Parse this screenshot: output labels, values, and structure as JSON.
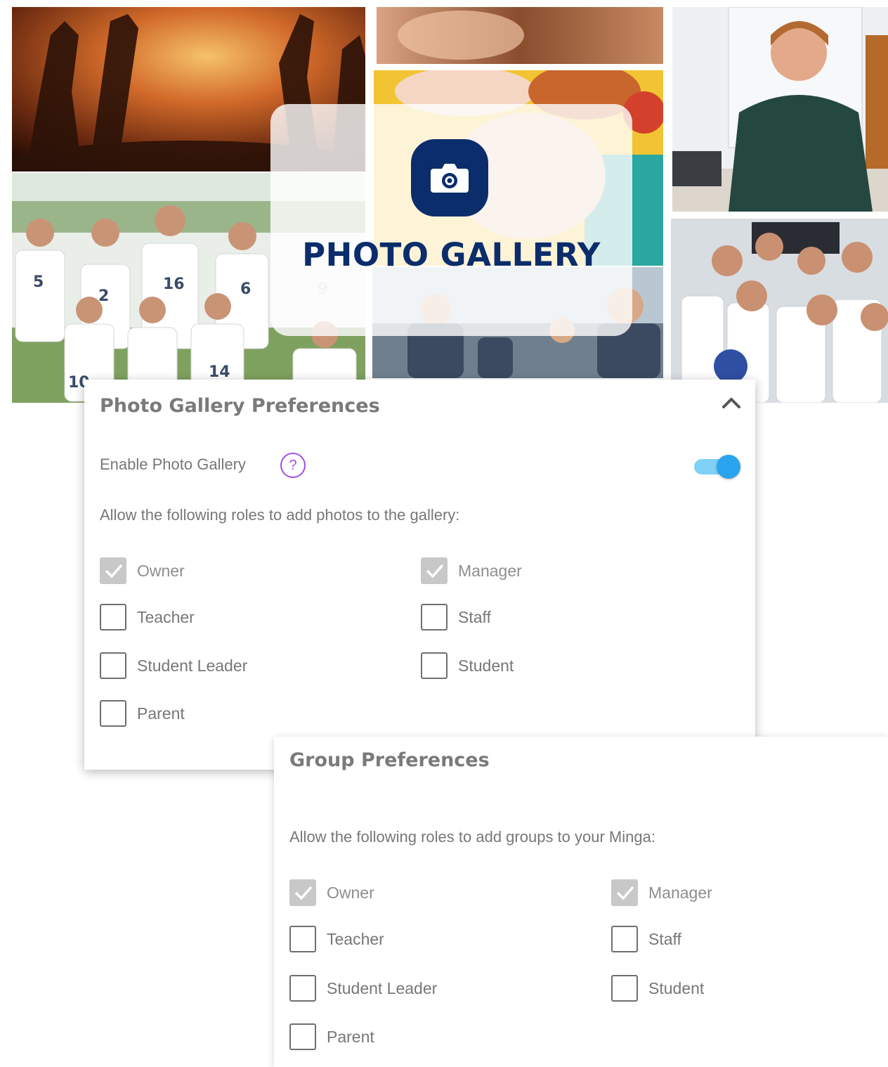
{
  "gallery_banner": {
    "title": "PHOTO GALLERY",
    "icon": "camera-icon",
    "accent": "#0b2d6b"
  },
  "photos": {
    "team_jerseys": [
      "5",
      "2",
      "16",
      "6",
      "9",
      "14",
      "10"
    ]
  },
  "photo_gallery_preferences": {
    "title": "Photo Gallery Preferences",
    "collapse_icon": "chevron-up-icon",
    "enable_label": "Enable Photo Gallery",
    "help_icon": "?",
    "enabled": true,
    "toggle_color": "#2aa4ee",
    "instructions": "Allow the following roles to add photos to the gallery:",
    "roles": [
      {
        "label": "Owner",
        "checked": true
      },
      {
        "label": "Manager",
        "checked": true
      },
      {
        "label": "Teacher",
        "checked": false
      },
      {
        "label": "Staff",
        "checked": false
      },
      {
        "label": "Student Leader",
        "checked": false
      },
      {
        "label": "Student",
        "checked": false
      },
      {
        "label": "Parent",
        "checked": false
      }
    ]
  },
  "group_preferences": {
    "title": "Group Preferences",
    "instructions": "Allow the following roles to add groups to your Minga:",
    "roles": [
      {
        "label": "Owner",
        "checked": true
      },
      {
        "label": "Manager",
        "checked": true
      },
      {
        "label": "Teacher",
        "checked": false
      },
      {
        "label": "Staff",
        "checked": false
      },
      {
        "label": "Student Leader",
        "checked": false
      },
      {
        "label": "Student",
        "checked": false
      },
      {
        "label": "Parent",
        "checked": false
      }
    ]
  }
}
